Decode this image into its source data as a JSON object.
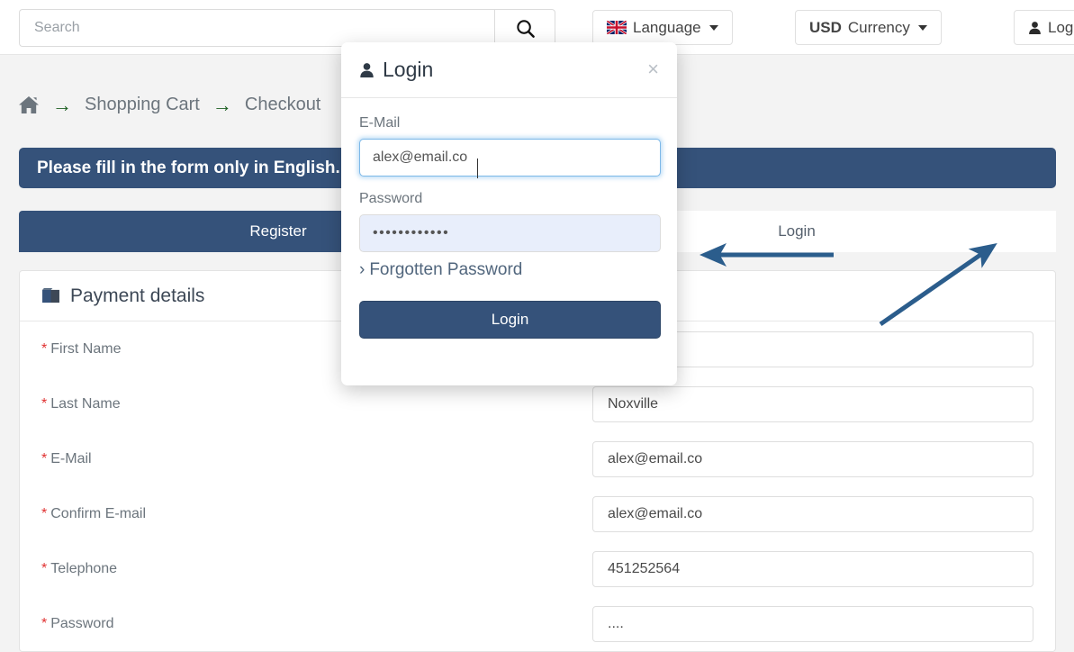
{
  "header": {
    "search_placeholder": "Search",
    "search_value": "",
    "search_icon": "search-icon",
    "language_button": {
      "label": "Language",
      "icon": "uk-flag-icon"
    },
    "currency_button": {
      "bold": "USD",
      "label": "Currency"
    },
    "account_button": {
      "label": "Login",
      "icon": "user-icon"
    }
  },
  "breadcrumb": {
    "home_icon": "home-icon",
    "separator": "→",
    "items": [
      "Shopping Cart",
      "Checkout"
    ]
  },
  "notice": {
    "text": "Please fill in the form only in English."
  },
  "tabs": [
    {
      "label": "Register",
      "active": true
    },
    {
      "label": "Login",
      "active": false
    }
  ],
  "panel": {
    "heading": "Payment details",
    "heading_icon": "book-icon",
    "fields": [
      {
        "label": "First Name",
        "required": true,
        "value": ""
      },
      {
        "label": "Last Name",
        "required": true,
        "value": "Noxville"
      },
      {
        "label": "E-Mail",
        "required": true,
        "value": "alex@email.co"
      },
      {
        "label": "Confirm E-mail",
        "required": true,
        "value": "alex@email.co"
      },
      {
        "label": "Telephone",
        "required": true,
        "value": "451252564"
      },
      {
        "label": "Password",
        "required": true,
        "value": "...."
      }
    ]
  },
  "modal": {
    "title": "Login",
    "title_icon": "user-icon",
    "close_label": "×",
    "email_label": "E-Mail",
    "email_value": "alex@email.co",
    "password_label": "Password",
    "password_value": "••••••••••••",
    "forgotten_label": "Forgotten Password",
    "forgotten_chevron": "›",
    "submit_label": "Login"
  },
  "annotations": {
    "arrow_color": "#2b5d8c",
    "arrow_horizontal": "points-left-to-register-tab",
    "arrow_diagonal": "points-up-right-to-login-tab"
  },
  "colors": {
    "brand_navy": "#35527a",
    "breadcrumb_arrow_green": "#1b5e20",
    "required_red": "#e03131",
    "page_bg": "#f3f3f3"
  }
}
